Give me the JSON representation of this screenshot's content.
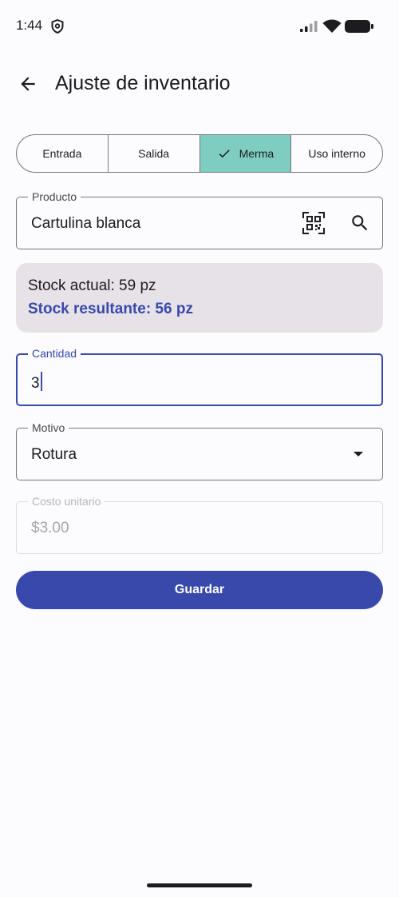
{
  "status_bar": {
    "time": "1:44"
  },
  "app_bar": {
    "title": "Ajuste de inventario"
  },
  "segments": [
    {
      "label": "Entrada",
      "selected": false
    },
    {
      "label": "Salida",
      "selected": false
    },
    {
      "label": "Merma",
      "selected": true
    },
    {
      "label": "Uso interno",
      "selected": false
    }
  ],
  "product_field": {
    "label": "Producto",
    "value": "Cartulina blanca"
  },
  "stock": {
    "current": "Stock actual: 59 pz",
    "resulting": "Stock resultante: 56 pz"
  },
  "quantity_field": {
    "label": "Cantidad",
    "value": "3"
  },
  "reason_field": {
    "label": "Motivo",
    "value": "Rotura"
  },
  "unit_cost_field": {
    "label": "Costo unitario",
    "value": "$3.00"
  },
  "save_button": {
    "label": "Guardar"
  },
  "colors": {
    "primary": "#3949ab",
    "selected_segment": "#7fcdc0",
    "stock_card_bg": "#e7e2e8",
    "background": "#fcfbfe"
  },
  "icons": {
    "back": "arrow-back-icon",
    "qr": "qr-code-scan-icon",
    "search": "search-icon",
    "dropdown": "dropdown-arrow-icon",
    "check": "check-icon"
  }
}
